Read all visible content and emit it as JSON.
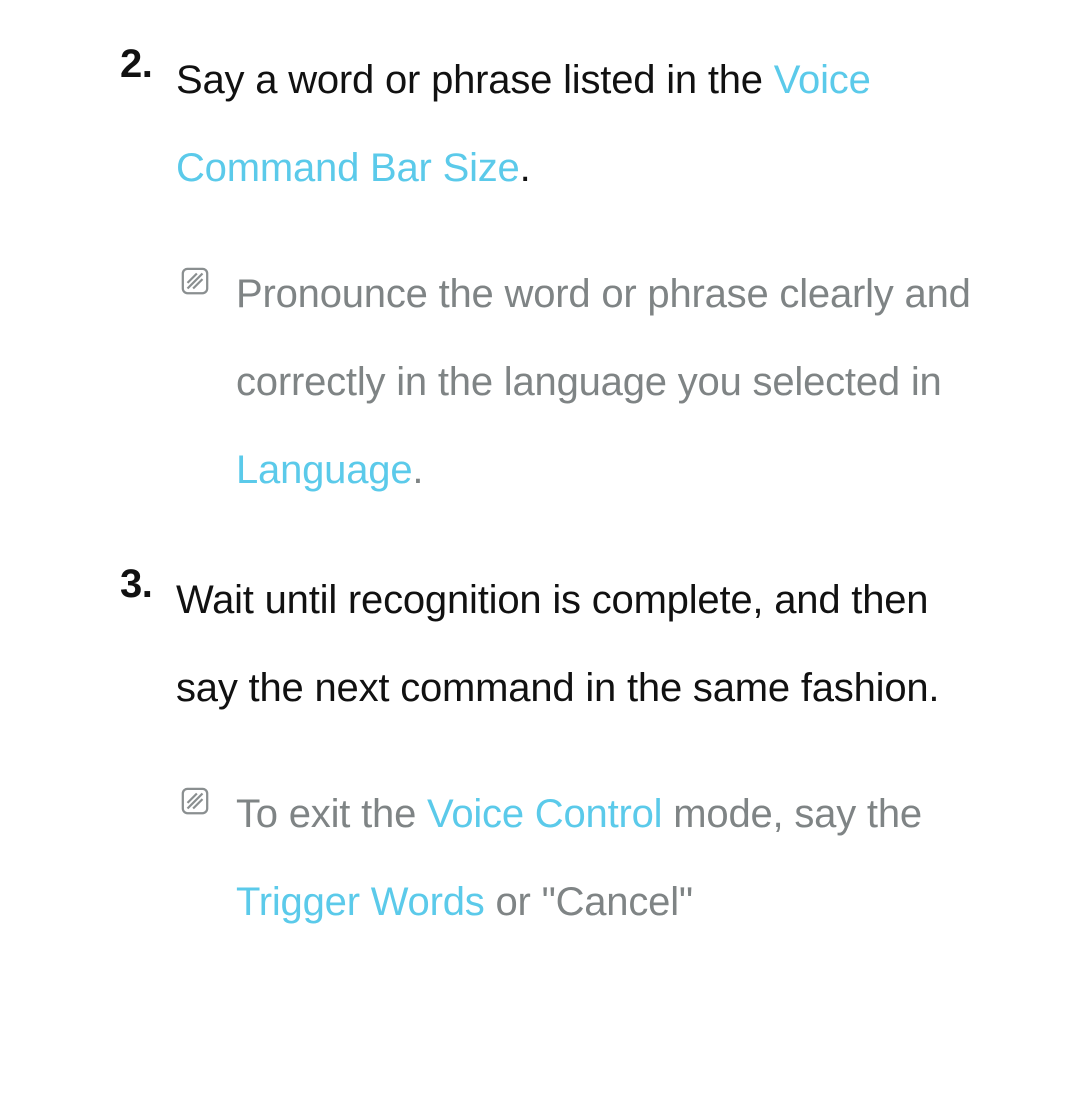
{
  "steps": [
    {
      "number": "2.",
      "text_before_link": "Say a word or phrase listed in the ",
      "link": "Voice Command Bar Size",
      "text_after_link": "."
    },
    {
      "number": "3.",
      "text": "Wait until recognition is complete, and then say the next command in the same fashion."
    }
  ],
  "notes": [
    {
      "text_before_link": "Pronounce the word or phrase clearly and correctly in the language you selected in ",
      "link": "Language",
      "text_after_link": "."
    },
    {
      "seg1": "To exit the ",
      "link1": "Voice Control",
      "seg2": " mode, say the ",
      "link2": "Trigger Words",
      "seg3": " or \"Cancel\""
    }
  ]
}
